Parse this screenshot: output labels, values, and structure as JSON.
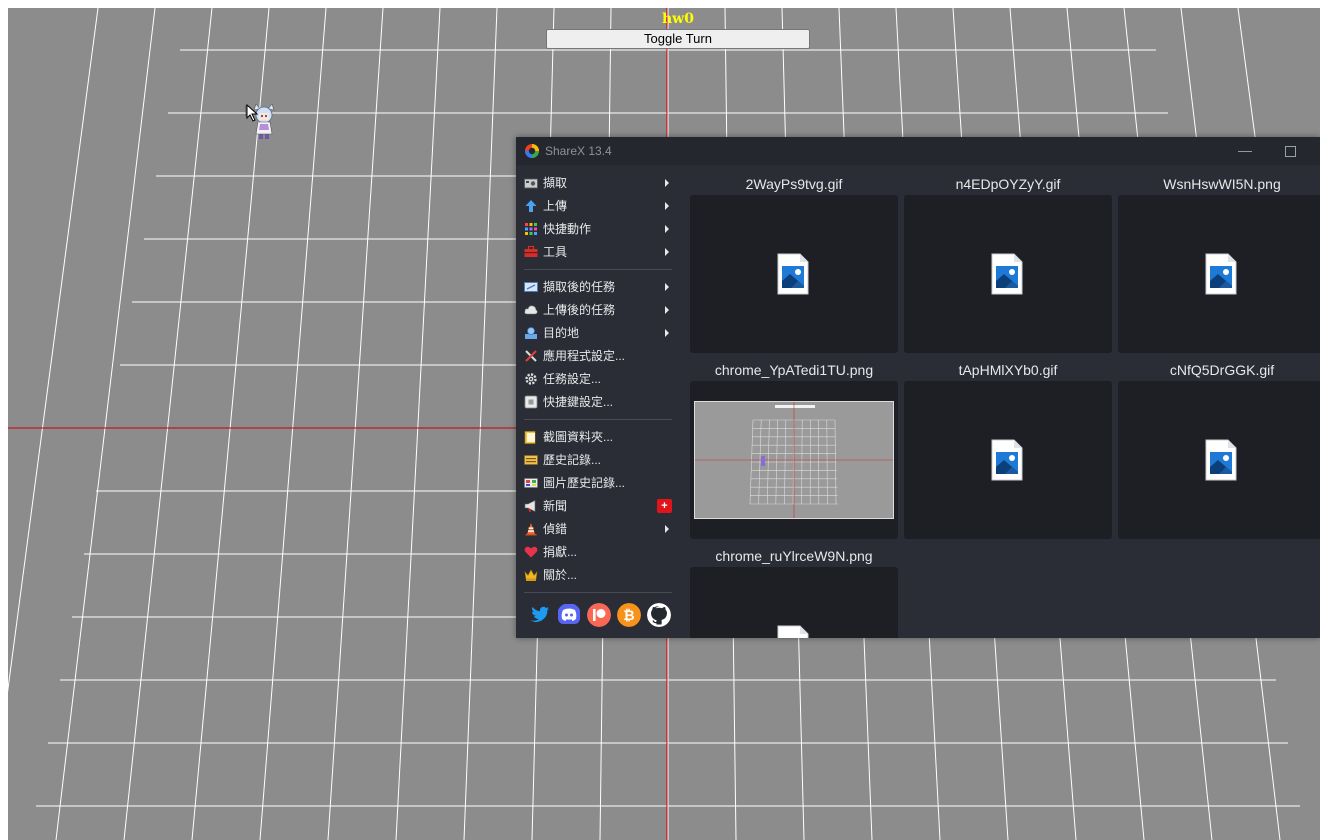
{
  "scene": {
    "title": "hw0",
    "toggle_label": "Toggle Turn",
    "background": "#8c8c8c",
    "grid_color": "#ffffff",
    "axis_color": "#cc0000",
    "title_color": "#ffff00"
  },
  "sharex": {
    "title": "ShareX 13.4",
    "minimize": "—",
    "menu": {
      "capture": "擷取",
      "upload": "上傳",
      "workflows": "快捷動作",
      "tools": "工具",
      "after_capture": "擷取後的任務",
      "after_upload": "上傳後的任務",
      "destinations": "目的地",
      "app_settings": "應用程式設定...",
      "task_settings": "任務設定...",
      "hotkey_settings": "快捷鍵設定...",
      "screenshots_folder": "截圖資料夾...",
      "history": "歷史記錄...",
      "image_history": "圖片歷史記錄...",
      "news": "新聞",
      "news_badge": "+",
      "debug": "偵錯",
      "donate": "捐獻...",
      "about": "關於..."
    },
    "social": [
      "twitter-icon",
      "discord-icon",
      "patreon-icon",
      "bitcoin-icon",
      "github-icon"
    ],
    "thumbnails": [
      {
        "name": "2WayPs9tvg.gif",
        "kind": "file-icon"
      },
      {
        "name": "n4EDpOYZyY.gif",
        "kind": "file-icon"
      },
      {
        "name": "WsnHswWI5N.png",
        "kind": "file-icon"
      },
      {
        "name": "chrome_YpATedi1TU.png",
        "kind": "screenshot"
      },
      {
        "name": "tApHMlXYb0.gif",
        "kind": "file-icon"
      },
      {
        "name": "cNfQ5DrGGK.gif",
        "kind": "file-icon"
      },
      {
        "name": "chrome_ruYlrceW9N.png",
        "kind": "file-icon"
      }
    ],
    "colors": {
      "window_bg": "#2a2d35",
      "titlebar_bg": "#24272d",
      "thumb_bg": "#1d1f24",
      "text": "#e6e8ea",
      "accent_red": "#e0151b"
    }
  }
}
